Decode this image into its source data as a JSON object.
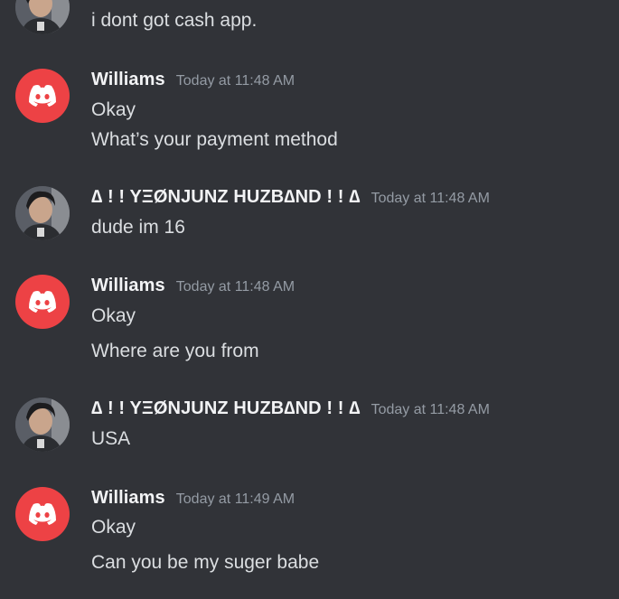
{
  "colors": {
    "background": "#313338",
    "text": "#dbdee1",
    "username": "#f2f3f5",
    "timestamp": "#949ba4",
    "discord_red": "#ed4245"
  },
  "messages": [
    {
      "avatar": "user-photo-avatar",
      "lines": [
        "i dont got cash app."
      ]
    },
    {
      "author": "Williams",
      "timestamp": "Today at 11:48 AM",
      "avatar": "discord-logo-avatar",
      "lines": [
        "Okay",
        "What’s your payment method"
      ]
    },
    {
      "author": "∆ ! ! YΞØNJUNZ HUZB∆ND ! ! ∆",
      "timestamp": "Today at 11:48 AM",
      "avatar": "user-photo-avatar",
      "lines": [
        "dude im 16"
      ]
    },
    {
      "author": "Williams",
      "timestamp": "Today at 11:48 AM",
      "avatar": "discord-logo-avatar",
      "lines": [
        "Okay",
        "Where are you from"
      ]
    },
    {
      "author": "∆ ! ! YΞØNJUNZ HUZB∆ND ! ! ∆",
      "timestamp": "Today at 11:48 AM",
      "avatar": "user-photo-avatar",
      "lines": [
        "USA"
      ]
    },
    {
      "author": "Williams",
      "timestamp": "Today at 11:49 AM",
      "avatar": "discord-logo-avatar",
      "lines": [
        "Okay",
        "Can you be my suger babe"
      ]
    }
  ]
}
